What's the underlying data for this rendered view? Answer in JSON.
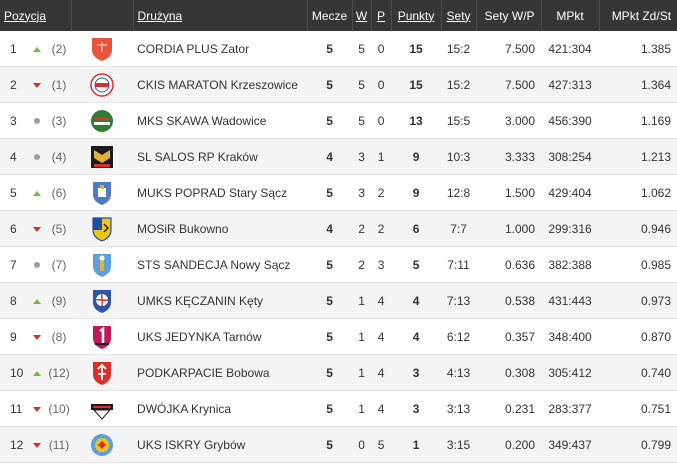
{
  "table": {
    "headers": {
      "position": "Pozycja",
      "team": "Drużyna",
      "played": "Mecze",
      "wins": "W",
      "losses": "P",
      "points": "Punkty",
      "sets": "Sety",
      "set_ratio": "Sety W/P",
      "small_points": "MPkt",
      "small_points_ratio": "MPkt Zd/St"
    },
    "rows": [
      {
        "rank": "1",
        "trend": "up",
        "prev": "(2)",
        "crest": "shield-red-icon",
        "team": "CORDIA PLUS Zator",
        "played": "5",
        "wins": "5",
        "losses": "0",
        "points": "15",
        "sets": "15:2",
        "set_ratio": "7.500",
        "small_points": "421:304",
        "small_points_ratio": "1.385"
      },
      {
        "rank": "2",
        "trend": "down",
        "prev": "(1)",
        "crest": "round-seal-icon",
        "team": "CKIS MARATON Krzeszowice",
        "played": "5",
        "wins": "5",
        "losses": "0",
        "points": "15",
        "sets": "15:2",
        "set_ratio": "7.500",
        "small_points": "427:313",
        "small_points_ratio": "1.364"
      },
      {
        "rank": "3",
        "trend": "same",
        "prev": "(3)",
        "crest": "green-red-stripes-icon",
        "team": "MKS SKAWA Wadowice",
        "played": "5",
        "wins": "5",
        "losses": "0",
        "points": "13",
        "sets": "15:5",
        "set_ratio": "3.000",
        "small_points": "456:390",
        "small_points_ratio": "1.169"
      },
      {
        "rank": "4",
        "trend": "same",
        "prev": "(4)",
        "crest": "salos-crest-icon",
        "team": "SL SALOS RP Kraków",
        "played": "4",
        "wins": "3",
        "losses": "1",
        "points": "9",
        "sets": "10:3",
        "set_ratio": "3.333",
        "small_points": "308:254",
        "small_points_ratio": "1.213"
      },
      {
        "rank": "5",
        "trend": "up",
        "prev": "(6)",
        "crest": "city-crest-icon",
        "team": "MUKS POPRAD Stary Sącz",
        "played": "5",
        "wins": "3",
        "losses": "2",
        "points": "9",
        "sets": "12:8",
        "set_ratio": "1.500",
        "small_points": "429:404",
        "small_points_ratio": "1.062"
      },
      {
        "rank": "6",
        "trend": "down",
        "prev": "(5)",
        "crest": "shield-split-icon",
        "team": "MOSiR Bukowno",
        "played": "4",
        "wins": "2",
        "losses": "2",
        "points": "6",
        "sets": "7:7",
        "set_ratio": "1.000",
        "small_points": "299:316",
        "small_points_ratio": "0.946"
      },
      {
        "rank": "7",
        "trend": "same",
        "prev": "(7)",
        "crest": "shield-blue-icon",
        "team": "STS SANDECJA Nowy Sącz",
        "played": "5",
        "wins": "2",
        "losses": "3",
        "points": "5",
        "sets": "7:11",
        "set_ratio": "0.636",
        "small_points": "382:388",
        "small_points_ratio": "0.985"
      },
      {
        "rank": "8",
        "trend": "up",
        "prev": "(9)",
        "crest": "volleyball-crest-icon",
        "team": "UMKS KĘCZANIN Kęty",
        "played": "5",
        "wins": "1",
        "losses": "4",
        "points": "4",
        "sets": "7:13",
        "set_ratio": "0.538",
        "small_points": "431:443",
        "small_points_ratio": "0.973"
      },
      {
        "rank": "9",
        "trend": "down",
        "prev": "(8)",
        "crest": "number-one-crest-icon",
        "team": "UKS JEDYNKA Tarnów",
        "played": "5",
        "wins": "1",
        "losses": "4",
        "points": "4",
        "sets": "6:12",
        "set_ratio": "0.357",
        "small_points": "348:400",
        "small_points_ratio": "0.870"
      },
      {
        "rank": "10",
        "trend": "up",
        "prev": "(12)",
        "crest": "shield-arrow-icon",
        "team": "PODKARPACIE Bobowa",
        "played": "5",
        "wins": "1",
        "losses": "4",
        "points": "3",
        "sets": "4:13",
        "set_ratio": "0.308",
        "small_points": "305:412",
        "small_points_ratio": "0.740"
      },
      {
        "rank": "11",
        "trend": "down",
        "prev": "(10)",
        "crest": "banner-crest-icon",
        "team": "DWÓJKA Krynica",
        "played": "5",
        "wins": "1",
        "losses": "4",
        "points": "3",
        "sets": "3:13",
        "set_ratio": "0.231",
        "small_points": "283:377",
        "small_points_ratio": "0.751"
      },
      {
        "rank": "12",
        "trend": "down",
        "prev": "(11)",
        "crest": "round-blue-crest-icon",
        "team": "UKS ISKRY Grybów",
        "played": "5",
        "wins": "0",
        "losses": "5",
        "points": "1",
        "sets": "3:15",
        "set_ratio": "0.200",
        "small_points": "349:437",
        "small_points_ratio": "0.799"
      }
    ]
  },
  "colors": {
    "header_bg": "#363636",
    "header_text": "#ffffff",
    "trend_up": "#7cb342",
    "trend_down": "#d9302c",
    "trend_same": "#9e9e9e",
    "row_alt": "#f4f4f4"
  }
}
